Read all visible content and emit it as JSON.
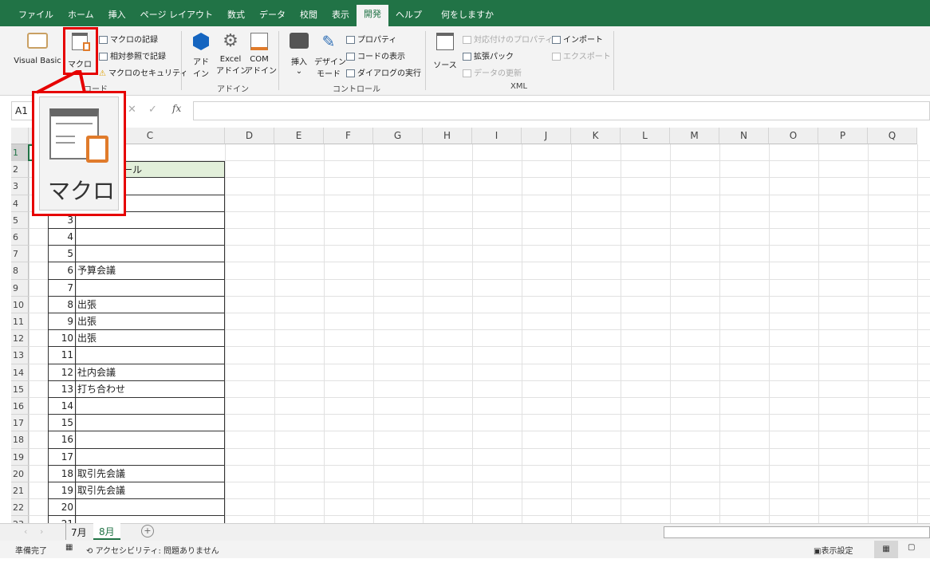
{
  "tabs": [
    "ファイル",
    "ホーム",
    "挿入",
    "ページ レイアウト",
    "数式",
    "データ",
    "校閲",
    "表示",
    "開発",
    "ヘルプ",
    "何をしますか"
  ],
  "active_tab": "開発",
  "ribbon": {
    "visual_basic": "Visual Basic",
    "macro": "マクロ",
    "record_macro": "マクロの記録",
    "relative_ref": "相対参照で記録",
    "macro_security": "マクロのセキュリティ",
    "group_code": "コード",
    "addin1": "アド",
    "addin2": "イン",
    "excel_addin1": "Excel",
    "excel_addin2": "アドイン",
    "com_addin1": "COM",
    "com_addin2": "アドイン",
    "group_addin": "アドイン",
    "insert": "挿入",
    "design1": "デザイン",
    "design2": "モード",
    "properties": "プロパティ",
    "view_code": "コードの表示",
    "run_dialog": "ダイアログの実行",
    "group_controls": "コントロール",
    "source": "ソース",
    "map_props": "対応付けのプロパティ",
    "expansion": "拡張パック",
    "refresh": "データの更新",
    "import": "インポート",
    "export": "エクスポート",
    "group_xml": "XML"
  },
  "callout": {
    "label": "マクロ",
    "color": "#e60000"
  },
  "formula": {
    "name_box": "A1",
    "fx": "fx"
  },
  "columns": [
    "C",
    "D",
    "E",
    "F",
    "G",
    "H",
    "I",
    "J",
    "K",
    "L",
    "M",
    "N",
    "O",
    "P",
    "Q"
  ],
  "rows": [
    "1",
    "2",
    "3",
    "4",
    "5",
    "6",
    "7",
    "8",
    "9",
    "10",
    "11",
    "12",
    "13",
    "14",
    "15",
    "16",
    "17",
    "18",
    "19",
    "20",
    "21",
    "22",
    "23"
  ],
  "table": {
    "header": "スケジュール",
    "days": [
      {
        "d": "1",
        "t": ""
      },
      {
        "d": "2",
        "t": ""
      },
      {
        "d": "3",
        "t": ""
      },
      {
        "d": "4",
        "t": ""
      },
      {
        "d": "5",
        "t": ""
      },
      {
        "d": "6",
        "t": "予算会議"
      },
      {
        "d": "7",
        "t": ""
      },
      {
        "d": "8",
        "t": "出張"
      },
      {
        "d": "9",
        "t": "出張"
      },
      {
        "d": "10",
        "t": "出張"
      },
      {
        "d": "11",
        "t": ""
      },
      {
        "d": "12",
        "t": "社内会議"
      },
      {
        "d": "13",
        "t": "打ち合わせ"
      },
      {
        "d": "14",
        "t": ""
      },
      {
        "d": "15",
        "t": ""
      },
      {
        "d": "16",
        "t": ""
      },
      {
        "d": "17",
        "t": ""
      },
      {
        "d": "18",
        "t": "取引先会議"
      },
      {
        "d": "19",
        "t": "取引先会議"
      },
      {
        "d": "20",
        "t": ""
      },
      {
        "d": "21",
        "t": ""
      }
    ]
  },
  "sheets": [
    "7月",
    "8月"
  ],
  "active_sheet": "8月",
  "status": {
    "ready": "準備完了",
    "accessibility": "アクセシビリティ: 問題ありません",
    "display_settings": "表示設定"
  },
  "colors": {
    "excel_green": "#217346",
    "header_fill": "#e2efda"
  }
}
